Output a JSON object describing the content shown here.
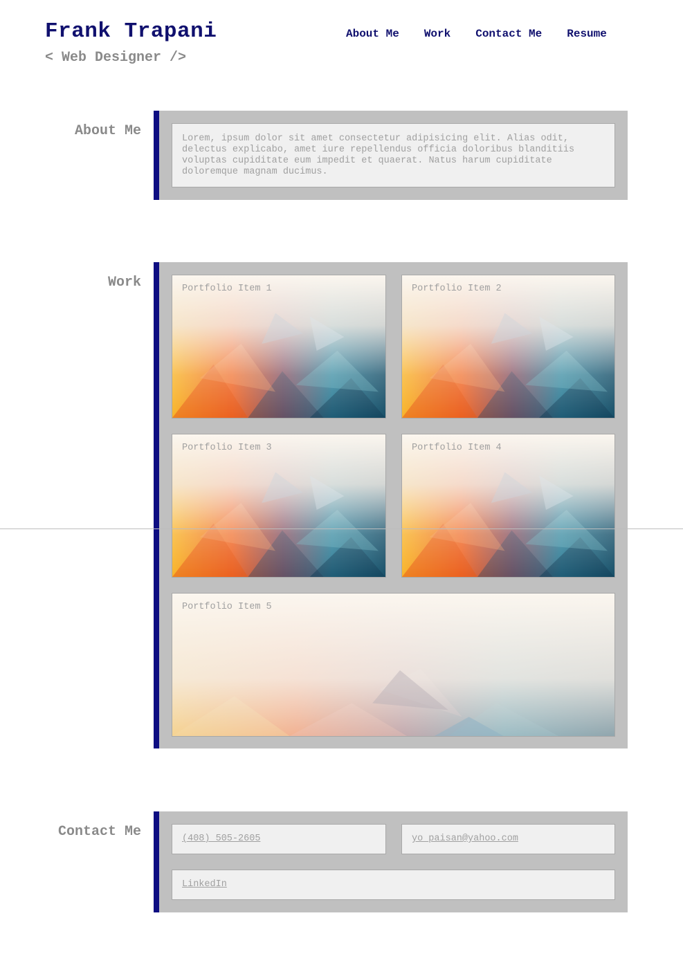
{
  "header": {
    "name": "Frank Trapani",
    "tagline": "< Web Designer />",
    "nav": [
      "About Me",
      "Work",
      "Contact Me",
      "Resume"
    ]
  },
  "about": {
    "label": "About Me",
    "text": "Lorem, ipsum dolor sit amet consectetur adipisicing elit. Alias odit, delectus explicabo, amet iure repellendus officia doloribus blanditiis voluptas cupiditate eum impedit et quaerat. Natus harum cupiditate doloremque magnam ducimus."
  },
  "work": {
    "label": "Work",
    "items": [
      "Portfolio Item 1",
      "Portfolio Item 2",
      "Portfolio Item 3",
      "Portfolio Item 4",
      "Portfolio Item 5"
    ]
  },
  "contact": {
    "label": "Contact Me",
    "phone": "(408) 505-2605",
    "email": "yo_paisan@yahoo.com",
    "linkedin": "LinkedIn"
  },
  "colors": {
    "accent": "#0e0e82",
    "panel": "#c0c0c0",
    "card": "#f0f0f0",
    "muted_text": "#8a8a8a"
  }
}
